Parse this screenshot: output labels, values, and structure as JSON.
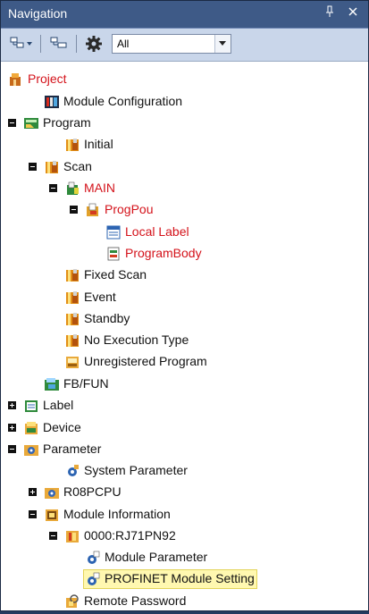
{
  "panel": {
    "title": "Navigation",
    "pin_glyph": "ᵖ",
    "close_glyph": "×"
  },
  "toolbar": {
    "buttons": [
      {
        "name": "expand-tree-icon"
      },
      {
        "name": "collapse-tree-icon"
      },
      {
        "name": "gear-icon"
      }
    ],
    "filter": {
      "value": "All"
    }
  },
  "tree": [
    {
      "label": "Project",
      "icon": "project-icon",
      "red": true,
      "expander": null
    },
    {
      "label": "Module Configuration",
      "icon": "module-configuration-icon",
      "red": false,
      "expander": null
    },
    {
      "label": "Program",
      "icon": "program-icon",
      "red": false,
      "expander": "minus"
    },
    {
      "label": "Initial",
      "icon": "program-folder-icon",
      "red": false,
      "expander": null
    },
    {
      "label": "Scan",
      "icon": "program-folder-icon",
      "red": false,
      "expander": "minus"
    },
    {
      "label": "MAIN",
      "icon": "program-file-icon",
      "red": true,
      "expander": "minus"
    },
    {
      "label": "ProgPou",
      "icon": "pou-icon",
      "red": true,
      "expander": "minus"
    },
    {
      "label": "Local Label",
      "icon": "local-label-icon",
      "red": true,
      "expander": null
    },
    {
      "label": "ProgramBody",
      "icon": "program-body-icon",
      "red": true,
      "expander": null
    },
    {
      "label": "Fixed Scan",
      "icon": "program-folder-icon",
      "red": false,
      "expander": null
    },
    {
      "label": "Event",
      "icon": "program-folder-icon",
      "red": false,
      "expander": null
    },
    {
      "label": "Standby",
      "icon": "program-folder-icon",
      "red": false,
      "expander": null
    },
    {
      "label": "No Execution Type",
      "icon": "program-folder-icon",
      "red": false,
      "expander": null
    },
    {
      "label": "Unregistered Program",
      "icon": "unregistered-program-icon",
      "red": false,
      "expander": null
    },
    {
      "label": "FB/FUN",
      "icon": "fb-fun-icon",
      "red": false,
      "expander": null
    },
    {
      "label": "Label",
      "icon": "label-icon",
      "red": false,
      "expander": "plus"
    },
    {
      "label": "Device",
      "icon": "device-icon",
      "red": false,
      "expander": "plus"
    },
    {
      "label": "Parameter",
      "icon": "parameter-icon",
      "red": false,
      "expander": "minus"
    },
    {
      "label": "System Parameter",
      "icon": "system-parameter-icon",
      "red": false,
      "expander": null
    },
    {
      "label": "R08PCPU",
      "icon": "cpu-parameter-icon",
      "red": false,
      "expander": "plus"
    },
    {
      "label": "Module Information",
      "icon": "module-information-icon",
      "red": false,
      "expander": "minus"
    },
    {
      "label": "0000:RJ71PN92",
      "icon": "module-icon",
      "red": false,
      "expander": "minus"
    },
    {
      "label": "Module Parameter",
      "icon": "module-parameter-icon",
      "red": false,
      "expander": null
    },
    {
      "label": "PROFINET Module Setting",
      "icon": "profinet-setting-icon",
      "red": false,
      "expander": null,
      "selected": true
    },
    {
      "label": "Remote Password",
      "icon": "remote-password-icon",
      "red": false,
      "expander": null
    }
  ]
}
